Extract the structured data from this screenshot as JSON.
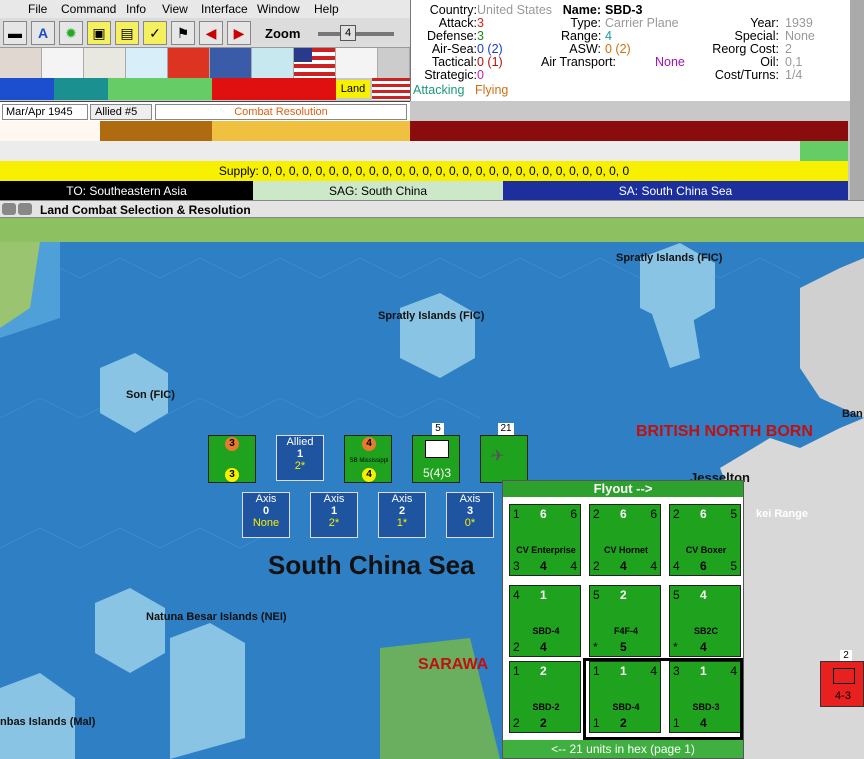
{
  "menu": [
    "File",
    "Command",
    "Info",
    "View",
    "Interface",
    "Window",
    "Help"
  ],
  "toolbar": {
    "zoom_label": "Zoom",
    "zoom_value": "4"
  },
  "status": {
    "date": "Mar/Apr 1945",
    "side": "Allied #5",
    "phase": "Combat Resolution",
    "land_badge": "Land"
  },
  "supply": "Supply: 0, 0, 0, 0, 0, 0, 0, 0, 0, 0, 0, 0, 0, 0, 0, 0, 0, 0, 0, 0, 0, 0, 0, 0, 0, 0, 0, 0",
  "theaters": {
    "to": "TO: Southeastern Asia",
    "sag": "SAG: South China",
    "sa": "SA: South China Sea"
  },
  "unit": {
    "country_l": "Country:",
    "country": "United States",
    "attack_l": "Attack:",
    "attack": "3",
    "defense_l": "Defense:",
    "defense": "3",
    "airsea_l": "Air-Sea:",
    "airsea": "0 (2)",
    "tactical_l": "Tactical:",
    "tactical": "0 (1)",
    "strategic_l": "Strategic:",
    "strategic": "0",
    "attacking": "Attacking",
    "flying": "Flying",
    "name_l": "Name:",
    "name": "SBD-3",
    "type_l": "Type:",
    "type": "Carrier Plane",
    "year_l": "Year:",
    "year": "1939",
    "range_l": "Range:",
    "range": "4",
    "special_l": "Special:",
    "special": "None",
    "asw_l": "ASW:",
    "asw": "0 (2)",
    "reorg_l": "Reorg Cost:",
    "reorg": "2",
    "airtrans_l": "Air Transport:",
    "airtrans": "None",
    "oil_l": "Oil:",
    "oil": "0,1",
    "cost_l": "Cost/Turns:",
    "cost": "1/4"
  },
  "window_title": "Land Combat Selection & Resolution",
  "map_labels": {
    "spratly1": "Spratly Islands (FIC)",
    "spratly2": "Spratly Islands (FIC)",
    "son": "Son (FIC)",
    "scs": "South China Sea",
    "natuna": "Natuna Besar Islands (NEI)",
    "anbas": "nbas Islands (Mal)",
    "sarawak": "SARAWA",
    "bnb": "BRITISH NORTH BORN",
    "jesselton": "Jesselton",
    "range": "kei Range",
    "ban": "Ban"
  },
  "combat": {
    "allied": {
      "label": "Allied",
      "num": "1",
      "val": "2*"
    },
    "axis": [
      {
        "label": "Axis",
        "num": "0",
        "val": "None"
      },
      {
        "label": "Axis",
        "num": "1",
        "val": "2*"
      },
      {
        "label": "Axis",
        "num": "2",
        "val": "1*"
      },
      {
        "label": "Axis",
        "num": "3",
        "val": "0*"
      }
    ],
    "stack_counts": [
      "5",
      "21"
    ],
    "hq_value": "5(4)3",
    "miss_label": "SB Mississippi"
  },
  "flyout": {
    "header": "Flyout -->",
    "footer": "<-- 21 units in hex (page 1)",
    "units": [
      {
        "name": "CV Enterprise",
        "tl": "1",
        "tm": "6",
        "tr": "6",
        "bl": "3",
        "bm": "4",
        "br": "4"
      },
      {
        "name": "CV Hornet",
        "tl": "2",
        "tm": "6",
        "tr": "6",
        "bl": "2",
        "bm": "4",
        "br": "4"
      },
      {
        "name": "CV Boxer",
        "tl": "2",
        "tm": "6",
        "tr": "5",
        "bl": "4",
        "bm": "6",
        "br": "5"
      },
      {
        "name": "SBD-4",
        "tl": "4",
        "tm": "1",
        "tr": "",
        "bl": "2",
        "bm": "4",
        "br": ""
      },
      {
        "name": "F4F-4",
        "tl": "5",
        "tm": "2",
        "tr": "",
        "bl": "*",
        "bm": "5",
        "br": ""
      },
      {
        "name": "SB2C",
        "tl": "5",
        "tm": "4",
        "tr": "",
        "bl": "*",
        "bm": "4",
        "br": ""
      },
      {
        "name": "SBD-2",
        "tl": "1",
        "tm": "2",
        "tr": "",
        "bl": "2",
        "bm": "2",
        "br": ""
      },
      {
        "name": "SBD-4",
        "tl": "1",
        "tm": "1",
        "tr": "4",
        "bl": "1",
        "bm": "2",
        "br": ""
      },
      {
        "name": "SBD-3",
        "tl": "3",
        "tm": "1",
        "tr": "4",
        "bl": "1",
        "bm": "4",
        "br": ""
      }
    ]
  },
  "enemy": {
    "count": "2",
    "value": "4-3"
  },
  "colors": {
    "sea": "#2e7fc4",
    "counter_green": "#1fa31f",
    "info_blue": "#1e54a0",
    "supply_yellow": "#f7f000"
  }
}
